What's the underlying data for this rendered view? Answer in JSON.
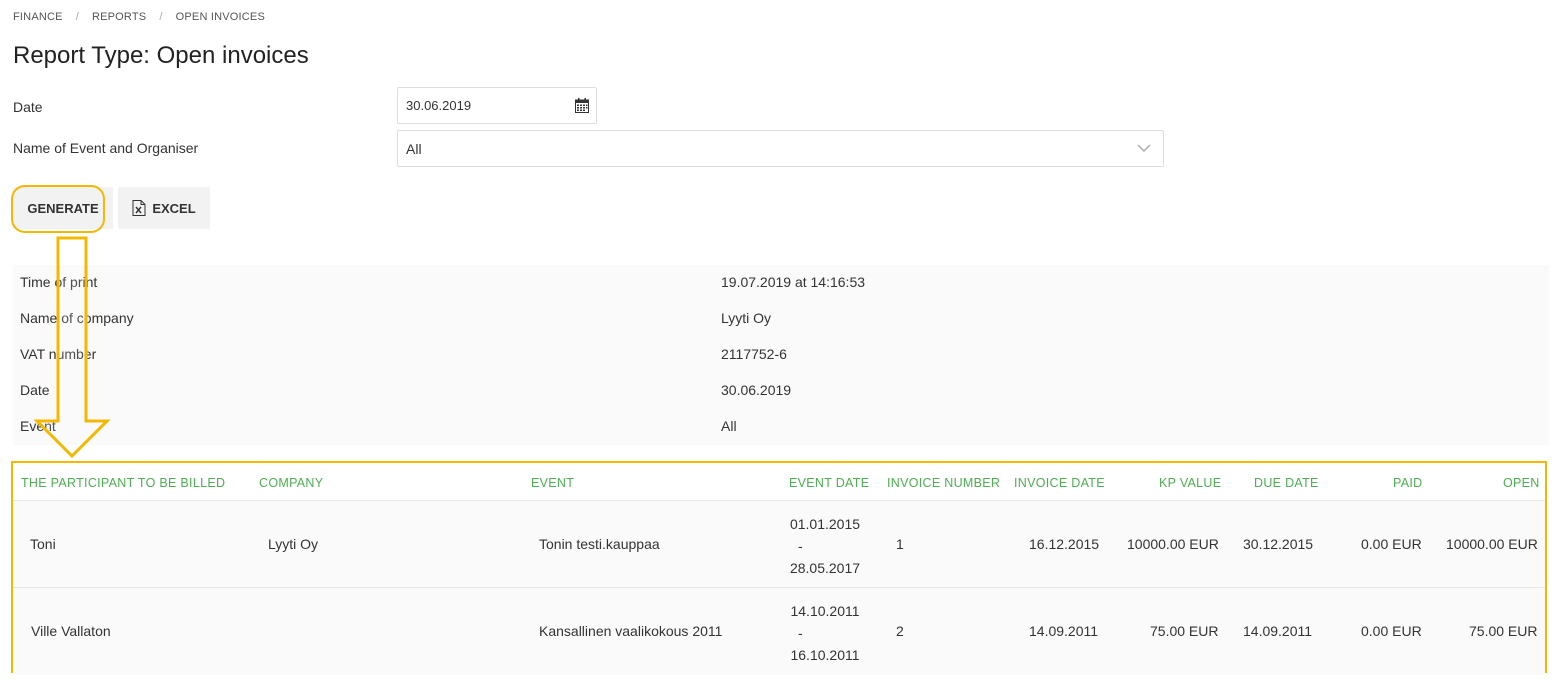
{
  "breadcrumb": [
    "Finance",
    "Reports",
    "Open invoices"
  ],
  "page_title": "Report Type: Open invoices",
  "form": {
    "date_label": "Date",
    "date_value": "30.06.2019",
    "event_label": "Name of Event and Organiser",
    "event_value": "All"
  },
  "buttons": {
    "generate": "GENERATE",
    "excel": "EXCEL"
  },
  "info": [
    {
      "key": "Time of print",
      "value": "19.07.2019 at 14:16:53"
    },
    {
      "key": "Name of company",
      "value": "Lyyti Oy"
    },
    {
      "key": "VAT number",
      "value": "2117752-6"
    },
    {
      "key": "Date",
      "value": "30.06.2019"
    },
    {
      "key": "Event",
      "value": "All"
    }
  ],
  "table": {
    "headers": [
      "THE PARTICIPANT TO BE BILLED",
      "COMPANY",
      "EVENT",
      "EVENT DATE",
      "INVOICE NUMBER",
      "INVOICE DATE",
      "KP VALUE",
      "DUE DATE",
      "PAID",
      "OPEN"
    ],
    "rows": [
      {
        "participant": "Toni",
        "company": "Lyyti Oy",
        "event": "Tonin testi.kauppaa",
        "event_date_start": "01.01.2015",
        "event_date_sep": "-",
        "event_date_end": "28.05.2017",
        "invoice_number": "1",
        "invoice_date": "16.12.2015",
        "kp_value": "10000.00 EUR",
        "due_date": "30.12.2015",
        "paid": "0.00 EUR",
        "open": "10000.00 EUR"
      },
      {
        "participant": "Ville Vallaton",
        "company": "",
        "event": "Kansallinen vaalikokous 2011",
        "event_date_start": "14.10.2011",
        "event_date_sep": "-",
        "event_date_end": "16.10.2011",
        "invoice_number": "2",
        "invoice_date": "14.09.2011",
        "kp_value": "75.00 EUR",
        "due_date": "14.09.2011",
        "paid": "0.00 EUR",
        "open": "75.00 EUR"
      }
    ]
  },
  "colors": {
    "highlight": "#f5b800",
    "header_text": "#4caf50"
  }
}
